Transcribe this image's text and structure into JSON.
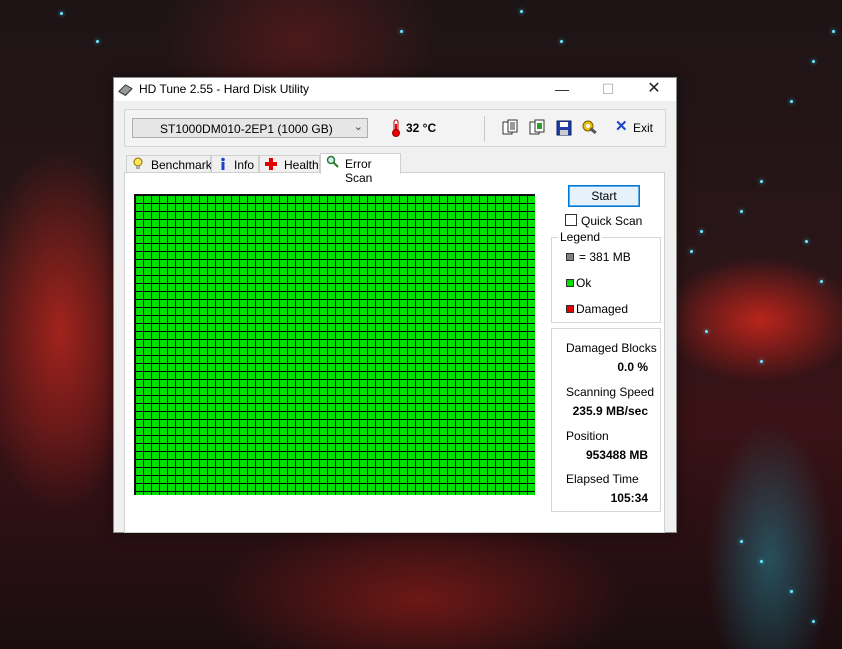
{
  "window": {
    "title": "HD Tune 2.55 - Hard Disk Utility",
    "controls": {
      "minimize": "—",
      "maximize": "☐",
      "close": "✕"
    }
  },
  "toolbar": {
    "drive": "ST1000DM010-2EP1 (1000 GB)",
    "temperature": "32 °C",
    "exit_label": "Exit",
    "icons": [
      "copy-text-icon",
      "copy-screenshot-icon",
      "save-icon",
      "options-icon"
    ]
  },
  "tabs": [
    {
      "label": "Benchmark",
      "icon": "benchmark-icon"
    },
    {
      "label": "Info",
      "icon": "info-icon"
    },
    {
      "label": "Health",
      "icon": "health-icon"
    },
    {
      "label": "Error Scan",
      "icon": "magnifier-icon",
      "active": true
    }
  ],
  "scan": {
    "start_label": "Start",
    "quick_scan_label": "Quick Scan",
    "quick_scan_checked": false,
    "block_color": "#00e000"
  },
  "legend": {
    "title": "Legend",
    "items": [
      {
        "label": "= 381 MB",
        "color": "#808080"
      },
      {
        "label": "Ok",
        "color": "#00e000"
      },
      {
        "label": "Damaged",
        "color": "#e00000"
      }
    ]
  },
  "stats": {
    "damaged_blocks_label": "Damaged Blocks",
    "damaged_blocks_value": "0.0 %",
    "scanning_speed_label": "Scanning Speed",
    "scanning_speed_value": "235.9 MB/sec",
    "position_label": "Position",
    "position_value": "953488 MB",
    "elapsed_label": "Elapsed Time",
    "elapsed_value": "105:34"
  }
}
